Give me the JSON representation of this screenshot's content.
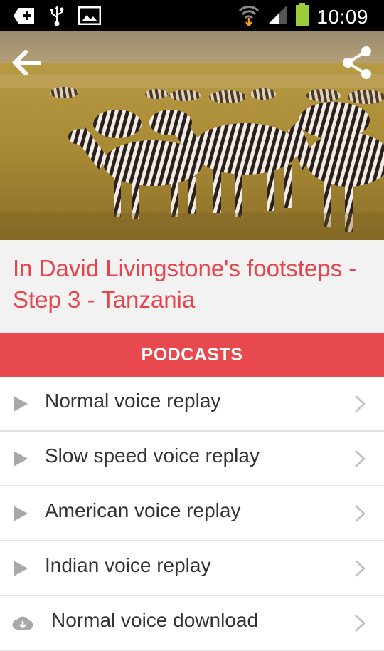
{
  "status_bar": {
    "time": "10:09",
    "icons": [
      "add-icon",
      "usb-icon",
      "image-icon",
      "wifi-icon",
      "signal-icon",
      "battery-icon"
    ]
  },
  "header": {
    "back_icon": "arrow-left-icon",
    "share_icon": "share-icon"
  },
  "article": {
    "title": "In David Livingstone's footsteps - Step 3 - Tanzania"
  },
  "podcasts": {
    "header": "PODCASTS",
    "items": [
      {
        "label": "Normal voice replay",
        "icon": "play-icon"
      },
      {
        "label": "Slow speed voice replay",
        "icon": "play-icon"
      },
      {
        "label": "American voice replay",
        "icon": "play-icon"
      },
      {
        "label": "Indian voice replay",
        "icon": "play-icon"
      },
      {
        "label": "Normal voice download",
        "icon": "cloud-download-icon"
      }
    ]
  },
  "colors": {
    "accent": "#e8494f",
    "title_text": "#e8434a",
    "title_bg": "#f2f2f2",
    "list_text": "#333333",
    "icon_gray": "#a8a8a8"
  }
}
